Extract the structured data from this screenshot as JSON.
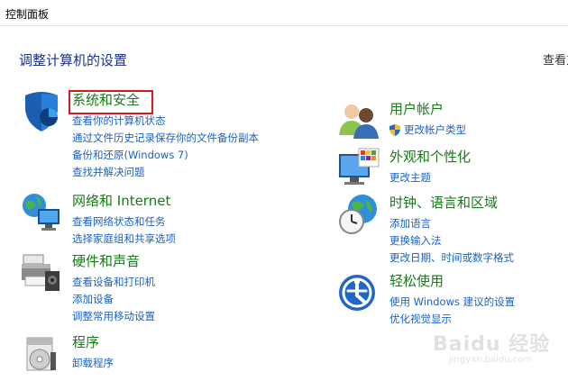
{
  "window": {
    "title": "控制面板"
  },
  "header": {
    "heading": "调整计算机的设置",
    "view_by": "查看方"
  },
  "categories": {
    "system_security": {
      "title": "系统和安全",
      "icon": "shield-icon",
      "links": [
        "查看你的计算机状态",
        "通过文件历史记录保存你的文件备份副本",
        "备份和还原(Windows 7)",
        "查找并解决问题"
      ]
    },
    "network": {
      "title": "网络和 Internet",
      "icon": "network-globe-icon",
      "links": [
        "查看网络状态和任务",
        "选择家庭组和共享选项"
      ]
    },
    "hardware": {
      "title": "硬件和声音",
      "icon": "printer-icon",
      "links": [
        "查看设备和打印机",
        "添加设备",
        "调整常用移动设置"
      ]
    },
    "programs": {
      "title": "程序",
      "icon": "programs-disc-icon",
      "links": [
        "卸载程序"
      ]
    },
    "user_accounts": {
      "title": "用户帐户",
      "icon": "users-icon",
      "links": [
        "更改帐户类型"
      ]
    },
    "appearance": {
      "title": "外观和个性化",
      "icon": "monitor-palette-icon",
      "links": [
        "更改主题"
      ]
    },
    "clock_region": {
      "title": "时钟、语言和区域",
      "icon": "clock-globe-icon",
      "links": [
        "添加语言",
        "更换输入法",
        "更改日期、时间或数字格式"
      ]
    },
    "ease_of_access": {
      "title": "轻松使用",
      "icon": "ease-of-access-icon",
      "links": [
        "使用 Windows 建议的设置",
        "优化视觉显示"
      ]
    }
  },
  "watermark": {
    "main": "Baidu 经验",
    "sub": "jingyan.baidu.com"
  },
  "colors": {
    "link": "#1a62c6",
    "category_title": "#1a7a1a",
    "heading": "#1e3287",
    "highlight": "#d6191d"
  }
}
